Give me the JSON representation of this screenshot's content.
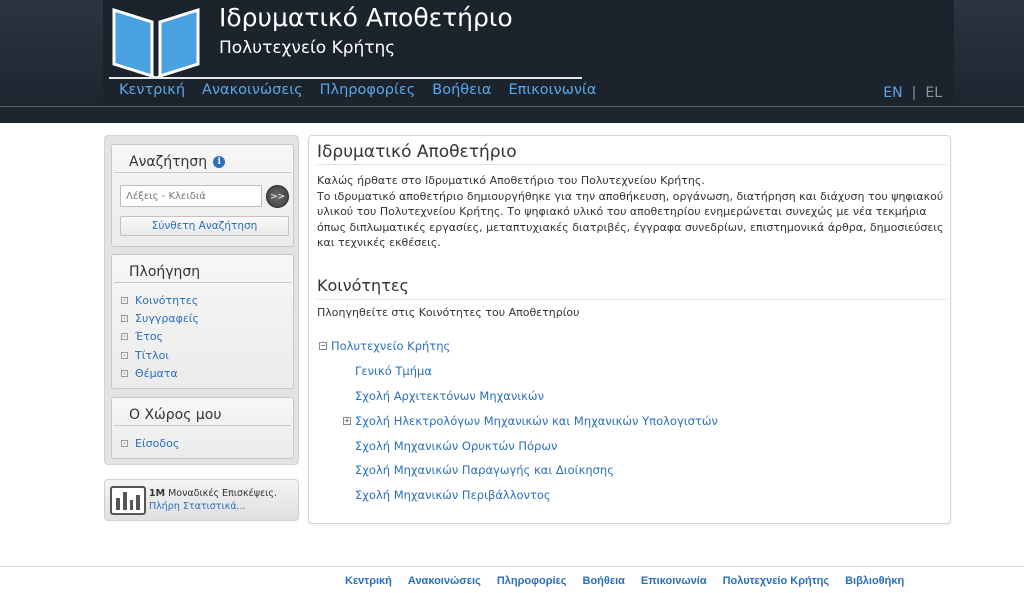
{
  "header": {
    "title": "Ιδρυματικό Αποθετήριο",
    "subtitle": "Πολυτεχνείο Κρήτης",
    "nav": [
      "Κεντρική",
      "Ανακοινώσεις",
      "Πληροφορίες",
      "Βοήθεια",
      "Επικοινωνία"
    ],
    "lang_en": "EN",
    "lang_sep": "|",
    "lang_el": "EL",
    "accent": "#5aa6e8",
    "logo_color": "#4aa3e0"
  },
  "sidebar": {
    "search": {
      "heading": "Αναζήτηση",
      "info_icon": "i",
      "placeholder": "Λέξεις - Κλειδιά",
      "go_label": ">>",
      "advanced_label": "Σύνθετη Αναζήτηση"
    },
    "browse": {
      "heading": "Πλοήγηση",
      "items": [
        "Κοινότητες",
        "Συγγραφείς",
        "Έτος",
        "Τίτλοι",
        "Θέματα"
      ]
    },
    "my_space": {
      "heading": "Ο Χώρος μου",
      "items": [
        "Είσοδος"
      ]
    },
    "stats": {
      "count": "1M",
      "label": "Μοναδικές Επισκέψεις.",
      "link": "Πλήρη Στατιστικά..."
    }
  },
  "main": {
    "title": "Ιδρυματικό Αποθετήριο",
    "intro_line1": "Καλώς ήρθατε στο Ιδρυματικό Αποθετήριο του Πολυτεχνείου Κρήτης.",
    "intro_line2": "Το ιδρυματικό αποθετήριο δημιουργήθηκε για την αποθήκευση, οργάνωση, διατήρηση και διάχυση του ψηφιακού υλικού του Πολυτεχνείου Κρήτης. Το ψηφιακό υλικό του αποθετηρίου ενημερώνεται συνεχώς με νέα τεκμήρια όπως διπλωματικές εργασίες, μεταπτυχιακές διατριβές, έγγραφα συνεδρίων, επιστημονικά άρθρα, δημοσιεύσεις και τεχνικές εκθέσεις.",
    "communities_title": "Κοινότητες",
    "communities_desc": "Πλοηγηθείτε στις Κοινότητες του Αποθετηρίου",
    "tree": {
      "root": "Πολυτεχνείο Κρήτης",
      "root_toggle": "−",
      "children": [
        "Γενικό Τμήμα",
        "Σχολή Αρχιτεκτόνων Μηχανικών",
        "Σχολή Ηλεκτρολόγων Μηχανικών και Μηχανικών Υπολογιστών",
        "Σχολή Μηχανικών Ορυκτών Πόρων",
        "Σχολή Μηχανικών Παραγωγής και Διοίκησης",
        "Σχολή Μηχανικών Περιβάλλοντος"
      ],
      "expand_toggle": "+"
    }
  },
  "footer": {
    "links": [
      "Κεντρική",
      "Ανακοινώσεις",
      "Πληροφορίες",
      "Βοήθεια",
      "Επικοινωνία",
      "Πολυτεχνείο Κρήτης",
      "Βιβλιοθήκη"
    ]
  }
}
